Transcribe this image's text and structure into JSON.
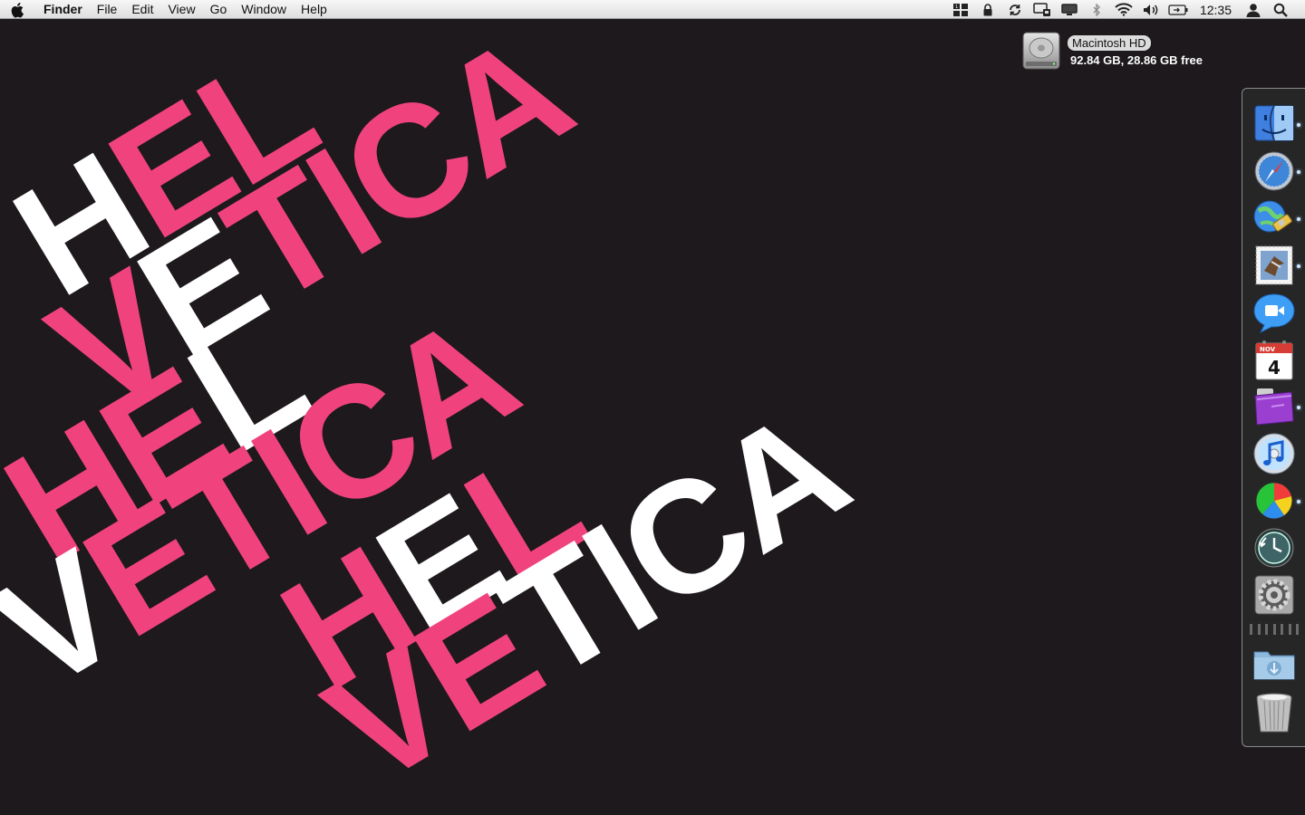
{
  "menubar": {
    "app_name": "Finder",
    "menus": [
      "File",
      "Edit",
      "View",
      "Go",
      "Window",
      "Help"
    ],
    "status_icons": [
      "spaces-icon",
      "lock-icon",
      "sync-icon",
      "display-mirroring-icon",
      "airplay-icon",
      "bluetooth-icon",
      "wifi-icon",
      "volume-icon",
      "battery-icon"
    ],
    "clock": "12:35",
    "user_icon": "user-icon",
    "search_icon": "spotlight-icon"
  },
  "desktop": {
    "drive": {
      "name": "Macintosh HD",
      "info": "92.84 GB, 28.86 GB free"
    },
    "wallpaper": {
      "words": [
        "HEL",
        "VETICA",
        "HEL",
        "VETICA",
        "HEL",
        "VETICA"
      ],
      "colors": {
        "pink": "#f0437d",
        "white": "#ffffff",
        "background": "#1d191c"
      }
    }
  },
  "dock": {
    "position": "right",
    "apps": [
      {
        "name": "Finder",
        "icon": "finder-icon",
        "running": true
      },
      {
        "name": "Safari",
        "icon": "safari-icon",
        "running": true
      },
      {
        "name": "Network Utility",
        "icon": "network-globe-icon",
        "running": true
      },
      {
        "name": "Mail",
        "icon": "mail-icon",
        "running": true
      },
      {
        "name": "iChat",
        "icon": "ichat-icon",
        "running": false
      },
      {
        "name": "iCal",
        "icon": "ical-icon",
        "running": false
      },
      {
        "name": "Purple Folder App",
        "icon": "purple-folder-icon",
        "running": true
      },
      {
        "name": "iTunes",
        "icon": "itunes-icon",
        "running": false
      },
      {
        "name": "Colour Wheel",
        "icon": "color-wheel-icon",
        "running": true
      },
      {
        "name": "Time Machine",
        "icon": "time-machine-icon",
        "running": false
      },
      {
        "name": "System Preferences",
        "icon": "system-preferences-icon",
        "running": false
      }
    ],
    "calendar_month": "NOV",
    "calendar_day": "4",
    "stacks": [
      {
        "name": "Downloads",
        "icon": "downloads-folder-icon"
      },
      {
        "name": "Trash",
        "icon": "trash-icon"
      }
    ]
  }
}
